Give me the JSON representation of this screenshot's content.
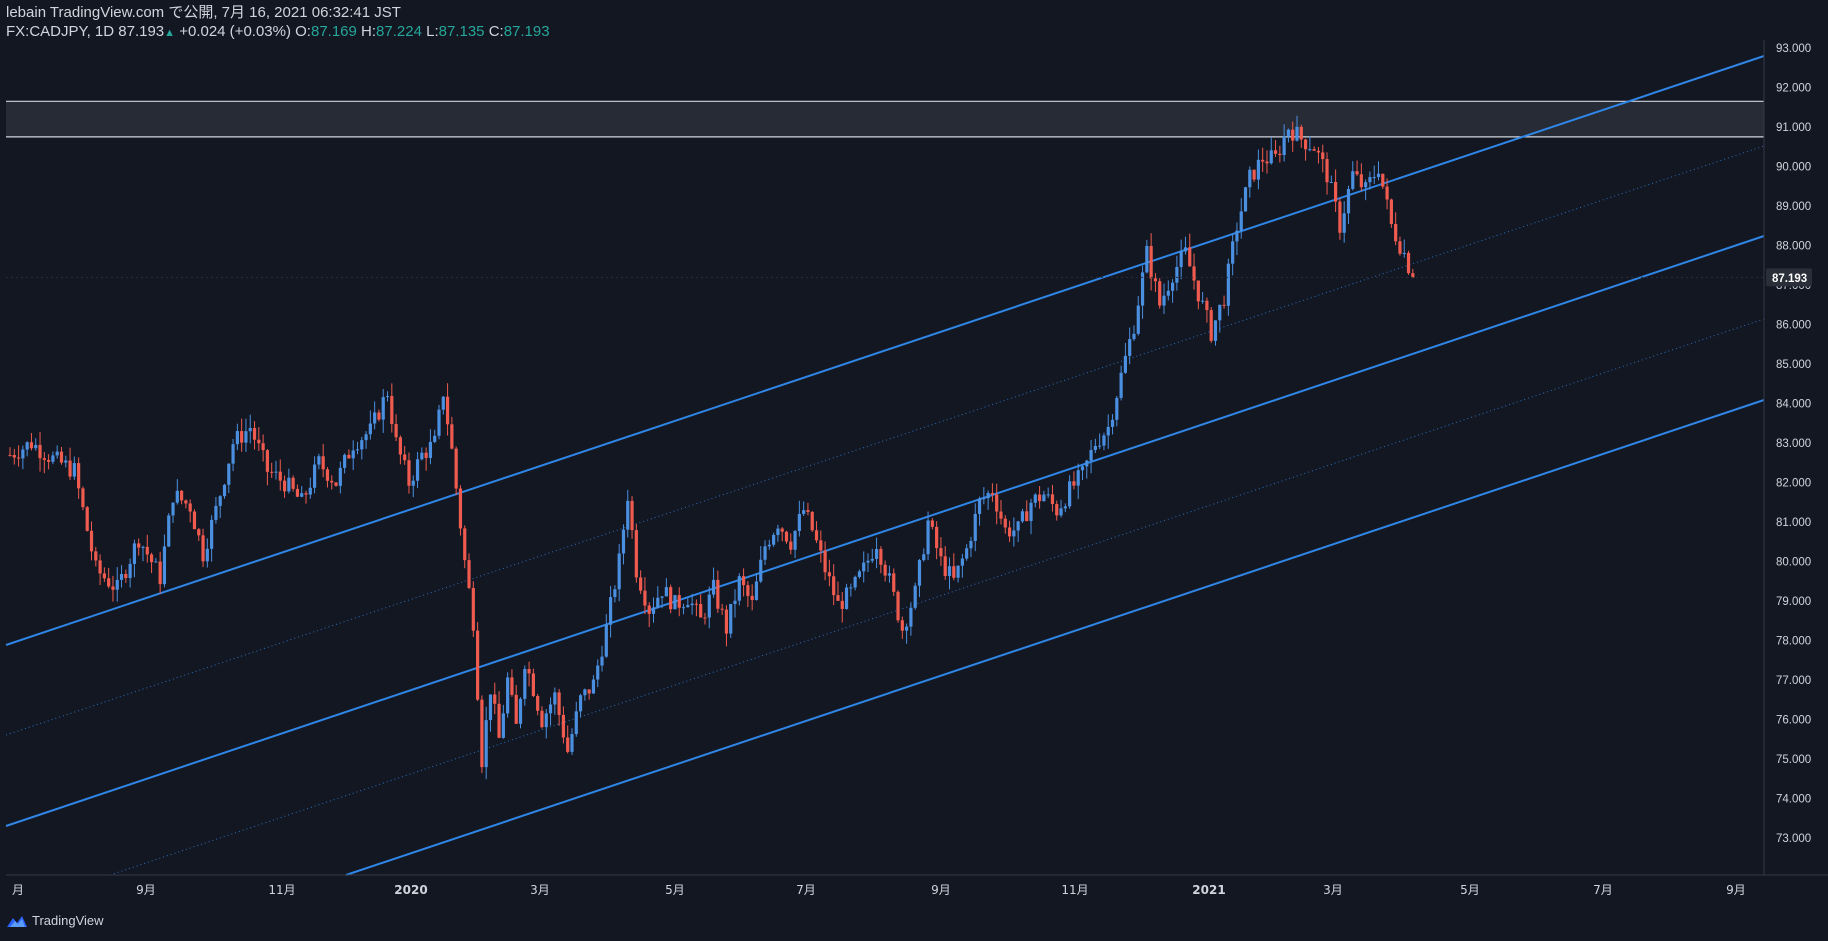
{
  "header": {
    "publish_line": "lebain TradingView.com で公開, 7月 16, 2021 06:32:41 JST",
    "symbol": "FX:CADJPY, 1D",
    "last": "87.193",
    "change": "+0.024 (+0.03%)",
    "o_label": "O:",
    "o_value": "87.169",
    "h_label": "H:",
    "h_value": "87.224",
    "l_label": "L:",
    "l_value": "87.135",
    "c_label": "C:",
    "c_value": "87.193"
  },
  "footer": {
    "brand": "TradingView"
  },
  "colors": {
    "background": "#131722",
    "up": "#4a8fe0",
    "down": "#f05b4f",
    "channel": "#2f86e6",
    "resistance_zone": "#2a2e39",
    "text": "#d1d4dc",
    "accent": "#26a69a"
  },
  "chart_data": {
    "type": "candlestick",
    "symbol": "FX:CADJPY",
    "timeframe": "1D",
    "y_axis": {
      "min": 72.0,
      "max": 93.5,
      "ticks": [
        "93.000",
        "92.000",
        "91.000",
        "90.000",
        "89.000",
        "88.000",
        "87.000",
        "86.000",
        "85.000",
        "84.000",
        "83.000",
        "82.000",
        "81.000",
        "80.000",
        "79.000",
        "78.000",
        "77.000",
        "76.000",
        "75.000",
        "74.000",
        "73.000"
      ],
      "last_price_label": "87.193"
    },
    "x_axis": {
      "labels": [
        "月",
        "9月",
        "11月",
        "2020",
        "3月",
        "5月",
        "7月",
        "9月",
        "11月",
        "2021",
        "3月",
        "5月",
        "7月",
        "9月"
      ]
    },
    "price_path": [
      [
        0,
        82.7
      ],
      [
        5,
        83.0
      ],
      [
        10,
        82.6
      ],
      [
        15,
        82.3
      ],
      [
        20,
        79.8
      ],
      [
        25,
        79.3
      ],
      [
        30,
        80.6
      ],
      [
        35,
        79.6
      ],
      [
        38,
        81.7
      ],
      [
        42,
        81.4
      ],
      [
        45,
        80.2
      ],
      [
        48,
        81.3
      ],
      [
        52,
        83.0
      ],
      [
        56,
        83.4
      ],
      [
        60,
        82.3
      ],
      [
        64,
        82.0
      ],
      [
        68,
        81.5
      ],
      [
        72,
        82.5
      ],
      [
        76,
        82.0
      ],
      [
        80,
        83.0
      ],
      [
        84,
        83.3
      ],
      [
        88,
        84.3
      ],
      [
        90,
        83.0
      ],
      [
        93,
        82.0
      ],
      [
        96,
        82.7
      ],
      [
        99,
        83.0
      ],
      [
        101,
        84.3
      ],
      [
        103,
        82.8
      ],
      [
        106,
        80.0
      ],
      [
        108,
        78.5
      ],
      [
        110,
        75.0
      ],
      [
        112,
        76.8
      ],
      [
        114,
        75.5
      ],
      [
        116,
        77.0
      ],
      [
        118,
        75.8
      ],
      [
        120,
        77.5
      ],
      [
        122,
        76.8
      ],
      [
        124,
        76.0
      ],
      [
        127,
        76.6
      ],
      [
        130,
        75.2
      ],
      [
        133,
        76.5
      ],
      [
        136,
        76.9
      ],
      [
        139,
        78.3
      ],
      [
        142,
        80.0
      ],
      [
        144,
        81.7
      ],
      [
        146,
        79.8
      ],
      [
        149,
        78.8
      ],
      [
        152,
        79.3
      ],
      [
        155,
        78.9
      ],
      [
        158,
        79.1
      ],
      [
        161,
        78.5
      ],
      [
        164,
        79.3
      ],
      [
        167,
        78.3
      ],
      [
        170,
        79.5
      ],
      [
        173,
        78.9
      ],
      [
        176,
        80.4
      ],
      [
        179,
        81.0
      ],
      [
        182,
        80.5
      ],
      [
        185,
        81.3
      ],
      [
        187,
        80.8
      ],
      [
        190,
        79.8
      ],
      [
        193,
        78.9
      ],
      [
        196,
        79.2
      ],
      [
        199,
        79.8
      ],
      [
        202,
        80.5
      ],
      [
        205,
        79.5
      ],
      [
        208,
        78.3
      ],
      [
        211,
        79.2
      ],
      [
        214,
        81.0
      ],
      [
        217,
        80.0
      ],
      [
        220,
        79.5
      ],
      [
        223,
        80.3
      ],
      [
        226,
        81.5
      ],
      [
        229,
        81.8
      ],
      [
        232,
        80.8
      ],
      [
        235,
        80.8
      ],
      [
        238,
        81.5
      ],
      [
        241,
        81.7
      ],
      [
        244,
        81.3
      ],
      [
        247,
        81.8
      ],
      [
        250,
        82.2
      ],
      [
        253,
        83.0
      ],
      [
        256,
        83.4
      ],
      [
        259,
        84.7
      ],
      [
        262,
        86.0
      ],
      [
        265,
        87.8
      ],
      [
        268,
        86.5
      ],
      [
        271,
        87.3
      ],
      [
        274,
        87.8
      ],
      [
        277,
        86.8
      ],
      [
        280,
        85.8
      ],
      [
        283,
        86.7
      ],
      [
        286,
        88.5
      ],
      [
        289,
        89.7
      ],
      [
        292,
        90.2
      ],
      [
        295,
        90.2
      ],
      [
        298,
        91.0
      ],
      [
        301,
        90.7
      ],
      [
        304,
        90.5
      ],
      [
        307,
        89.8
      ],
      [
        310,
        88.5
      ],
      [
        313,
        89.8
      ],
      [
        316,
        89.4
      ],
      [
        319,
        90.0
      ],
      [
        322,
        88.5
      ],
      [
        325,
        87.8
      ],
      [
        327,
        87.19
      ]
    ]
  }
}
